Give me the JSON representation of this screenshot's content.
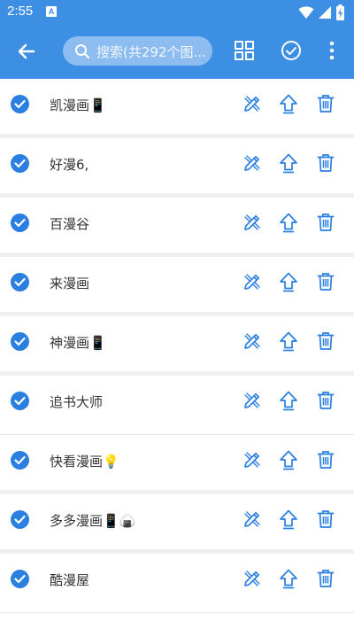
{
  "status": {
    "time": "2:55",
    "notif_badge": "A",
    "icons": [
      "wifi-icon",
      "signal-icon",
      "battery-charging-icon"
    ]
  },
  "toolbar": {
    "search_placeholder": "搜索(共292个图...",
    "icons": [
      "back-arrow-icon",
      "search-icon",
      "grid-icon",
      "check-circle-icon",
      "more-vert-icon"
    ]
  },
  "colors": {
    "accent": "#3d8fe4",
    "check": "#2a7fe0",
    "action": "#2a7fe0"
  },
  "sources": [
    {
      "name": "凯漫画📱",
      "checked": true
    },
    {
      "name": "好漫6,",
      "checked": true
    },
    {
      "name": "百漫谷",
      "checked": true
    },
    {
      "name": "来漫画",
      "checked": true
    },
    {
      "name": "神漫画📱",
      "checked": true
    },
    {
      "name": "追书大师",
      "checked": true
    },
    {
      "name": "快看漫画💡",
      "checked": true
    },
    {
      "name": "多多漫画📱🍙",
      "checked": true
    },
    {
      "name": "酷漫屋",
      "checked": true
    }
  ]
}
